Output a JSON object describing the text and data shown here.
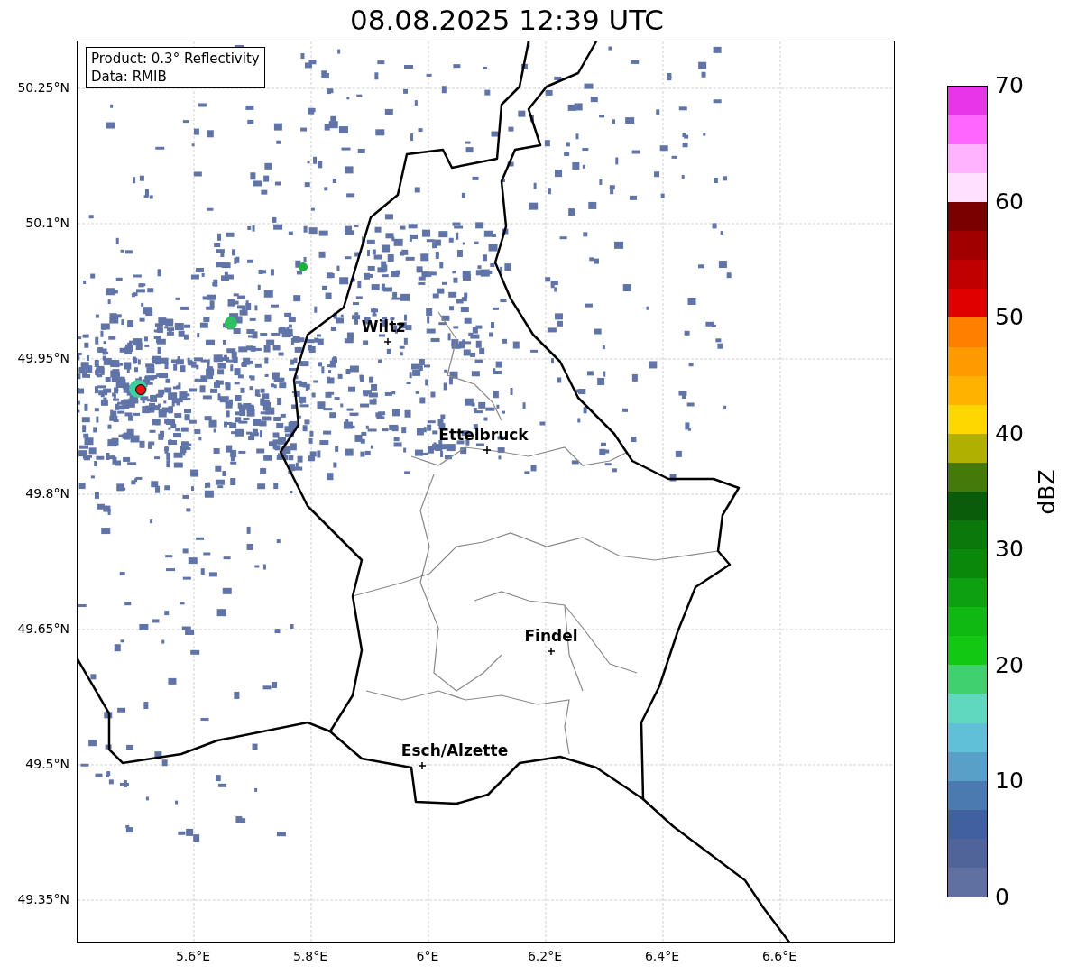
{
  "title": "08.08.2025 12:39 UTC",
  "legend": {
    "lines": [
      "Product: 0.3° Reflectivity",
      "Data: RMIB"
    ]
  },
  "map": {
    "lat_ticks": [
      "50.25°N",
      "50.1°N",
      "49.95°N",
      "49.8°N",
      "49.65°N",
      "49.5°N",
      "49.35°N"
    ],
    "lon_ticks": [
      "5.6°E",
      "5.8°E",
      "6°E",
      "6.2°E",
      "6.4°E",
      "6.6°E"
    ],
    "places": [
      {
        "name": "Wiltz"
      },
      {
        "name": "Ettelbruck"
      },
      {
        "name": "Findel"
      },
      {
        "name": "Esch/Alzette"
      }
    ]
  },
  "colorbar": {
    "label": "dBZ",
    "ticks": [
      "70",
      "60",
      "50",
      "40",
      "30",
      "20",
      "10",
      "0"
    ],
    "bins": [
      {
        "color": "#6070a0"
      },
      {
        "color": "#50649a"
      },
      {
        "color": "#4060a0"
      },
      {
        "color": "#4a7ab0"
      },
      {
        "color": "#58a0c8"
      },
      {
        "color": "#60c0d8"
      },
      {
        "color": "#60d8c0"
      },
      {
        "color": "#40d070"
      },
      {
        "color": "#12c812"
      },
      {
        "color": "#10b812"
      },
      {
        "color": "#0da010"
      },
      {
        "color": "#0a880a"
      },
      {
        "color": "#0a780a"
      },
      {
        "color": "#0a5c0a"
      },
      {
        "color": "#447a0a"
      },
      {
        "color": "#b0b000"
      },
      {
        "color": "#ffd700"
      },
      {
        "color": "#ffb300"
      },
      {
        "color": "#ff9a00"
      },
      {
        "color": "#ff7f00"
      },
      {
        "color": "#e00000"
      },
      {
        "color": "#c00000"
      },
      {
        "color": "#a00000"
      },
      {
        "color": "#7a0000"
      },
      {
        "color": "#ffe0ff"
      },
      {
        "color": "#ffb3ff"
      },
      {
        "color": "#ff66ff"
      },
      {
        "color": "#e935e9"
      }
    ]
  }
}
